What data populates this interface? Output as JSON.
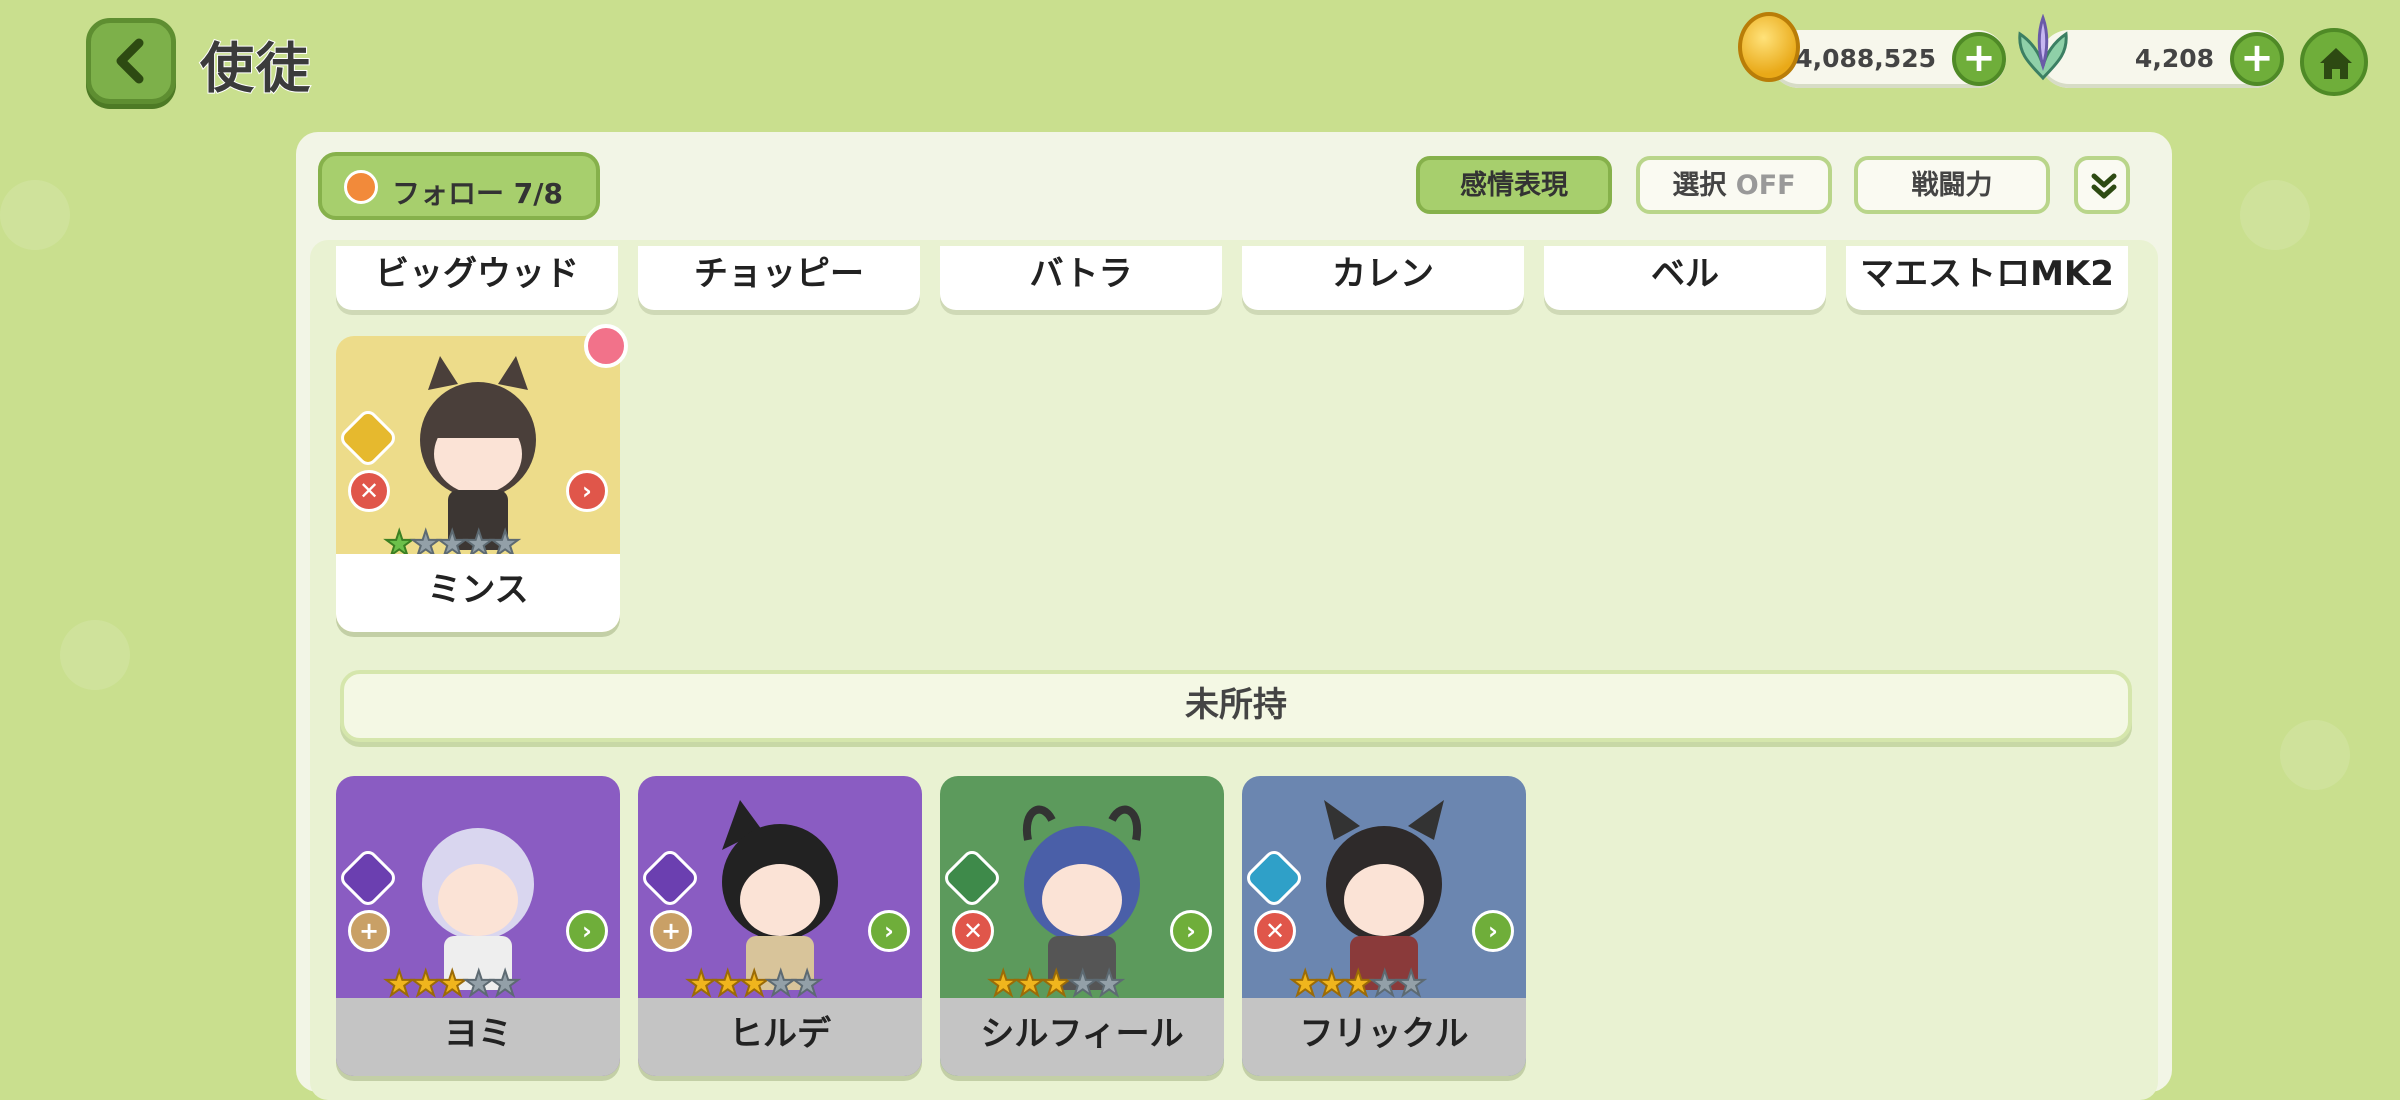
{
  "header": {
    "title": "使徒",
    "gold_amount": "4,088,525",
    "crystal_amount": "4,208"
  },
  "toolbar": {
    "follow_label": "フォロー",
    "follow_count": "7/8",
    "emotion_label": "感情表現",
    "select_label": "選択",
    "select_state": "OFF",
    "power_label": "戦闘力"
  },
  "name_row": [
    "ビッグウッド",
    "チョッピー",
    "バトラ",
    "カレン",
    "ベル",
    "マエストロMK2"
  ],
  "owned": [
    {
      "name": "ミンス",
      "stars": 1,
      "bg": "#eddc8a",
      "plate": "#ffffff",
      "element_color": "#e6b92e",
      "role_color": "#e0564a"
    }
  ],
  "section_label": "未所持",
  "unowned": [
    {
      "name": "ヨミ",
      "stars": 3,
      "bg": "#8a5cc2",
      "element_color": "#6b3fb0",
      "role_color": "#c9a066"
    },
    {
      "name": "ヒルデ",
      "stars": 3,
      "bg": "#8a5cc2",
      "element_color": "#6b3fb0",
      "role_color": "#c9a066"
    },
    {
      "name": "シルフィール",
      "stars": 3,
      "bg": "#5c9a5c",
      "element_color": "#3e8a4a",
      "role_color": "#e0564a"
    },
    {
      "name": "フリックル",
      "stars": 3,
      "bg": "#6b86b0",
      "element_color": "#2fa0c8",
      "role_color": "#e0564a"
    }
  ],
  "colors": {
    "background": "#c9df8e",
    "accent_green": "#6fae3a",
    "panel": "#f2f5e6"
  }
}
